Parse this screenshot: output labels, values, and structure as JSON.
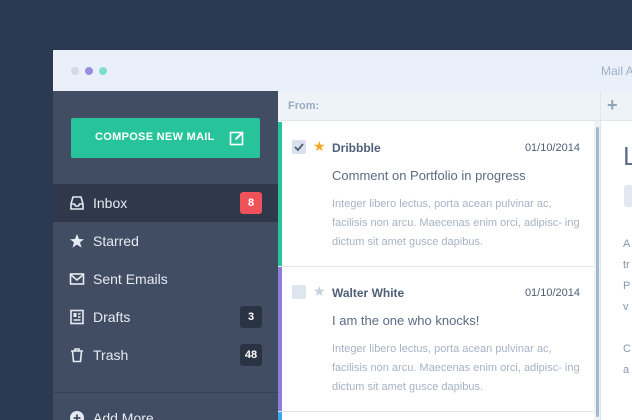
{
  "window": {
    "title": "Mail A",
    "traffic_dots": [
      "#d5dbe6",
      "#9b8ee0",
      "#7de0cc"
    ]
  },
  "sidebar": {
    "compose_label": "COMPOSE NEW MAIL",
    "compose_icon": "edit-icon",
    "items": [
      {
        "label": "Inbox",
        "icon": "inbox-icon",
        "badge": "8",
        "active": true
      },
      {
        "label": "Starred",
        "icon": "star-icon",
        "badge": ""
      },
      {
        "label": "Sent Emails",
        "icon": "envelope-icon",
        "badge": ""
      },
      {
        "label": "Drafts",
        "icon": "drafts-icon",
        "badge": "3"
      },
      {
        "label": "Trash",
        "icon": "trash-icon",
        "badge": "48"
      }
    ],
    "add_more_label": "Add More"
  },
  "list": {
    "from_label": "From:",
    "messages": [
      {
        "sender": "Dribbble",
        "date": "01/10/2014",
        "subject": "Comment on Portfolio in progress",
        "excerpt": "Integer libero lectus, porta acean pulvinar ac, facilisis non arcu. Maecenas enim orci, adipisc- ing dictum sit amet gusce dapibus.",
        "checked": true,
        "starred": true,
        "accent": "#27c49b"
      },
      {
        "sender": "Walter White",
        "date": "01/10/2014",
        "subject": "I am the one who knocks!",
        "excerpt": "Integer libero lectus, porta acean pulvinar ac, facilisis non arcu. Maecenas enim orci, adipisc- ing dictum sit amet gusce dapibus.",
        "checked": false,
        "starred": false,
        "accent": "#8b7fd9"
      }
    ]
  },
  "reading": {
    "add_label": "+",
    "title_fragment": "L",
    "text_lines": [
      "A",
      "tr",
      "P",
      "v",
      "",
      "C",
      "a"
    ]
  },
  "colors": {
    "accent_green": "#27c49b",
    "accent_purple": "#8b7fd9",
    "badge_red": "#f0525a",
    "sidebar_bg": "#414d63",
    "star_active": "#f5a623",
    "star_inactive": "#c7d1de"
  }
}
